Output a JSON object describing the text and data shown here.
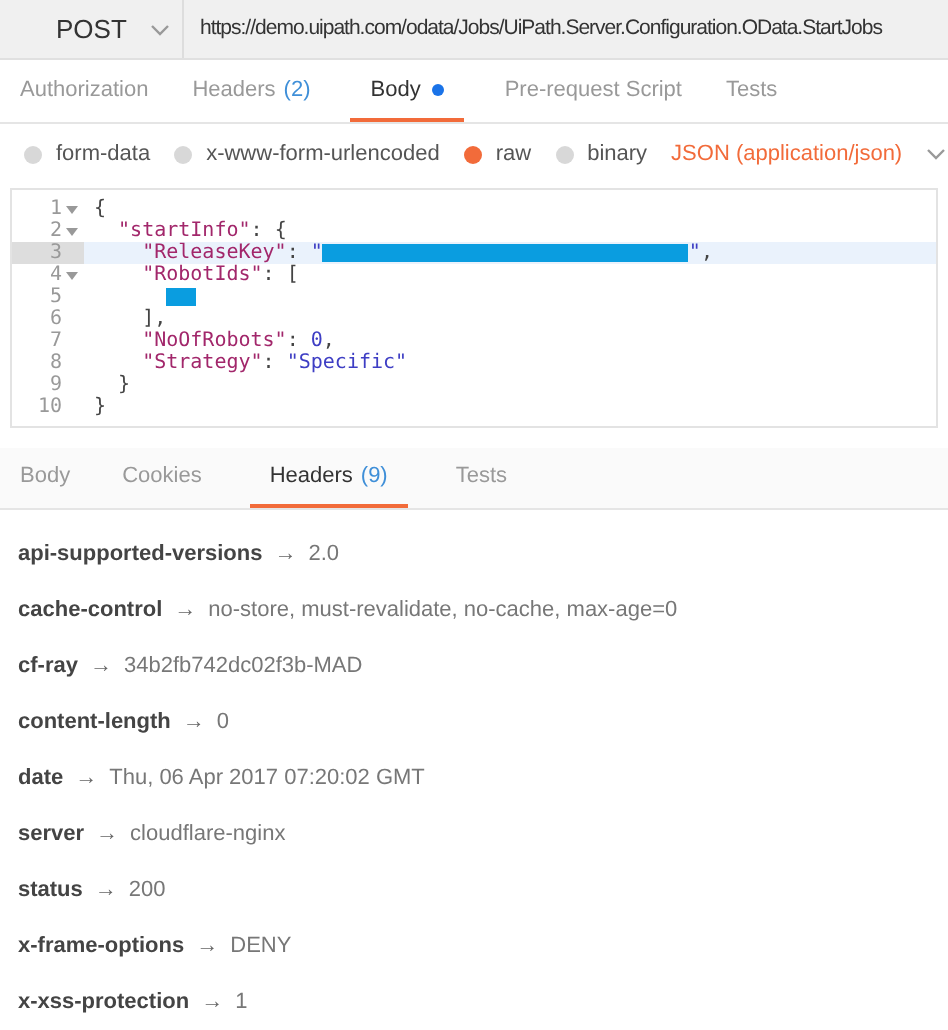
{
  "request": {
    "method": "POST",
    "url": "https://demo.uipath.com/odata/Jobs/UiPath.Server.Configuration.OData.StartJobs"
  },
  "request_tabs": [
    {
      "label": "Authorization",
      "selected": false
    },
    {
      "label": "Headers",
      "count": "(2)",
      "selected": false
    },
    {
      "label": "Body",
      "dot": true,
      "selected": true
    },
    {
      "label": "Pre-request Script",
      "selected": false
    },
    {
      "label": "Tests",
      "selected": false
    }
  ],
  "body_modes": [
    {
      "label": "form-data",
      "selected": false
    },
    {
      "label": "x-www-form-urlencoded",
      "selected": false
    },
    {
      "label": "raw",
      "selected": true
    },
    {
      "label": "binary",
      "selected": false
    }
  ],
  "content_type": "JSON (application/json)",
  "editor_lines": [
    {
      "number": "1",
      "foldable": true,
      "active": false,
      "tokens": [
        {
          "kind": "punct",
          "text": "{"
        }
      ]
    },
    {
      "number": "2",
      "foldable": true,
      "active": false,
      "tokens": [
        {
          "kind": "key",
          "text": "  \"startInfo\""
        },
        {
          "kind": "punct",
          "text": ": {"
        }
      ]
    },
    {
      "number": "3",
      "foldable": false,
      "active": true,
      "tokens": [
        {
          "kind": "key",
          "text": "    \"ReleaseKey\""
        },
        {
          "kind": "punct",
          "text": ": "
        },
        {
          "kind": "string",
          "text": "\""
        },
        {
          "kind": "redacted_long"
        },
        {
          "kind": "string",
          "text": "\""
        },
        {
          "kind": "punct",
          "text": ","
        }
      ]
    },
    {
      "number": "4",
      "foldable": true,
      "active": false,
      "tokens": [
        {
          "kind": "key",
          "text": "    \"RobotIds\""
        },
        {
          "kind": "punct",
          "text": ": ["
        }
      ]
    },
    {
      "number": "5",
      "foldable": false,
      "active": false,
      "tokens": [
        {
          "kind": "redacted_short"
        }
      ]
    },
    {
      "number": "6",
      "foldable": false,
      "active": false,
      "tokens": [
        {
          "kind": "punct",
          "text": "    ],"
        }
      ]
    },
    {
      "number": "7",
      "foldable": false,
      "active": false,
      "tokens": [
        {
          "kind": "key",
          "text": "    \"NoOfRobots\""
        },
        {
          "kind": "punct",
          "text": ": "
        },
        {
          "kind": "number",
          "text": "0"
        },
        {
          "kind": "punct",
          "text": ","
        }
      ]
    },
    {
      "number": "8",
      "foldable": false,
      "active": false,
      "tokens": [
        {
          "kind": "key",
          "text": "    \"Strategy\""
        },
        {
          "kind": "punct",
          "text": ": "
        },
        {
          "kind": "string",
          "text": "\"Specific\""
        }
      ]
    },
    {
      "number": "9",
      "foldable": false,
      "active": false,
      "tokens": [
        {
          "kind": "punct",
          "text": "  }"
        }
      ]
    },
    {
      "number": "10",
      "foldable": false,
      "active": false,
      "tokens": [
        {
          "kind": "punct",
          "text": "}"
        }
      ]
    }
  ],
  "response_tabs": [
    {
      "label": "Body",
      "selected": false
    },
    {
      "label": "Cookies",
      "selected": false
    },
    {
      "label": "Headers",
      "count": "(9)",
      "selected": true
    },
    {
      "label": "Tests",
      "selected": false
    }
  ],
  "response_headers": [
    {
      "name": "api-supported-versions",
      "arrow": "→",
      "value": "2.0"
    },
    {
      "name": "cache-control",
      "arrow": "→",
      "value": "no-store, must-revalidate, no-cache, max-age=0"
    },
    {
      "name": "cf-ray",
      "arrow": "→",
      "value": "34b2fb742dc02f3b-MAD"
    },
    {
      "name": "content-length",
      "arrow": "→",
      "value": "0"
    },
    {
      "name": "date",
      "arrow": "→",
      "value": "Thu, 06 Apr 2017 07:20:02 GMT"
    },
    {
      "name": "server",
      "arrow": "→",
      "value": "cloudflare-nginx"
    },
    {
      "name": "status",
      "arrow": "→",
      "value": "200"
    },
    {
      "name": "x-frame-options",
      "arrow": "→",
      "value": "DENY"
    },
    {
      "name": "x-xss-protection",
      "arrow": "→",
      "value": "1"
    }
  ]
}
